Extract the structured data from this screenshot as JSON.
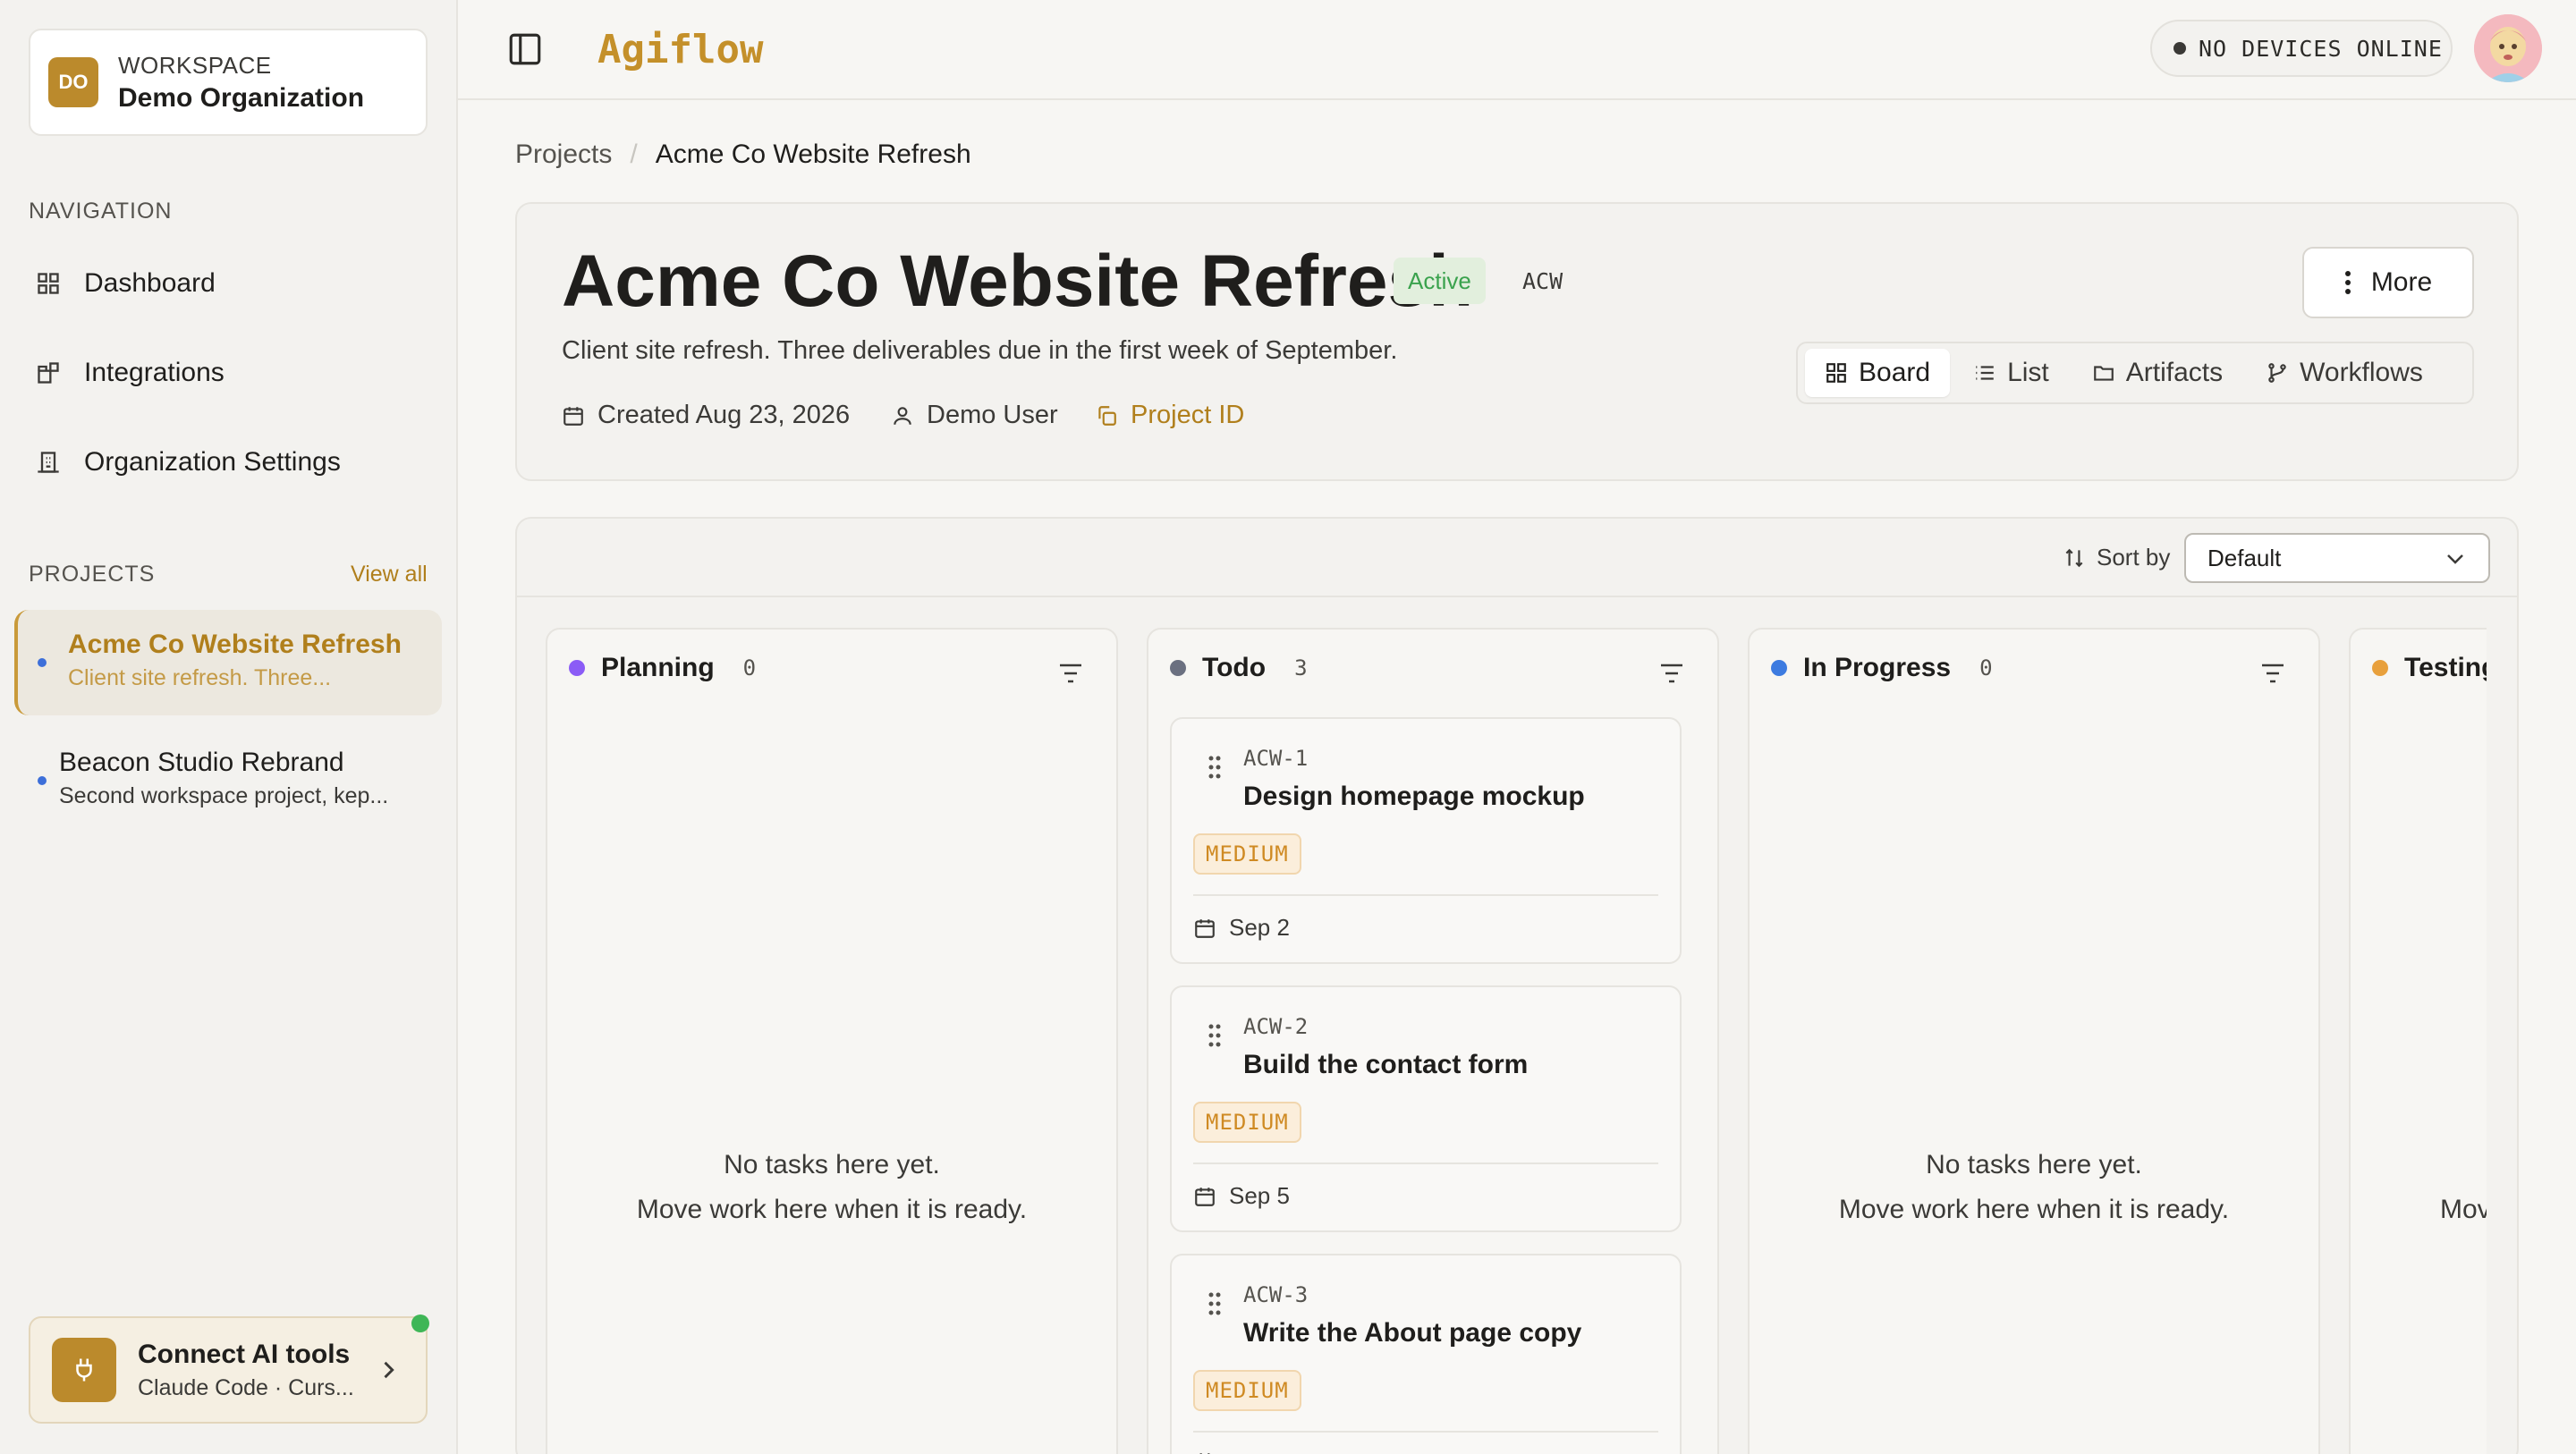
{
  "workspace": {
    "badge": "DO",
    "label": "WORKSPACE",
    "name": "Demo Organization"
  },
  "sidebar": {
    "navigation_label": "NAVIGATION",
    "nav": [
      {
        "label": "Dashboard",
        "icon": "grid-icon"
      },
      {
        "label": "Integrations",
        "icon": "puzzle-icon"
      },
      {
        "label": "Organization Settings",
        "icon": "building-icon"
      }
    ],
    "projects_label": "PROJECTS",
    "view_all": "View all",
    "projects": [
      {
        "title": "Acme Co Website Refresh",
        "subtitle": "Client site refresh. Three...",
        "active": true
      },
      {
        "title": "Beacon Studio Rebrand",
        "subtitle": "Second workspace project, kep...",
        "active": false
      }
    ],
    "connect": {
      "title": "Connect AI tools",
      "subtitle": "Claude Code · Curs..."
    }
  },
  "header": {
    "logo": "Agiflow",
    "devices": "NO DEVICES ONLINE"
  },
  "breadcrumb": {
    "parent": "Projects",
    "separator": "/",
    "current": "Acme Co Website Refresh"
  },
  "project": {
    "title": "Acme Co Website Refresh",
    "status": "Active",
    "key": "ACW",
    "more": "More",
    "description": "Client site refresh. Three deliverables due in the first week of September.",
    "created": "Created Aug 23, 2026",
    "owner": "Demo User",
    "project_id": "Project ID",
    "views": [
      "Board",
      "List",
      "Artifacts",
      "Workflows"
    ],
    "active_view": "Board"
  },
  "board": {
    "sort_label": "Sort by",
    "sort_value": "Default",
    "empty_line1": "No tasks here yet.",
    "empty_line2": "Move work here when it is ready.",
    "empty_line2_partial": "Mov",
    "columns": [
      {
        "title": "Planning",
        "count": "0",
        "color": "#8b5cf6"
      },
      {
        "title": "Todo",
        "count": "3",
        "color": "#6b7080"
      },
      {
        "title": "In Progress",
        "count": "0",
        "color": "#3d7be0"
      },
      {
        "title": "Testing",
        "count": "",
        "color": "#e8a03c"
      }
    ],
    "tasks": [
      {
        "key": "ACW-1",
        "title": "Design homepage mockup",
        "priority": "MEDIUM",
        "due": "Sep 2"
      },
      {
        "key": "ACW-2",
        "title": "Build the contact form",
        "priority": "MEDIUM",
        "due": "Sep 5"
      },
      {
        "key": "ACW-3",
        "title": "Write the About page copy",
        "priority": "MEDIUM",
        "due": ""
      }
    ]
  }
}
